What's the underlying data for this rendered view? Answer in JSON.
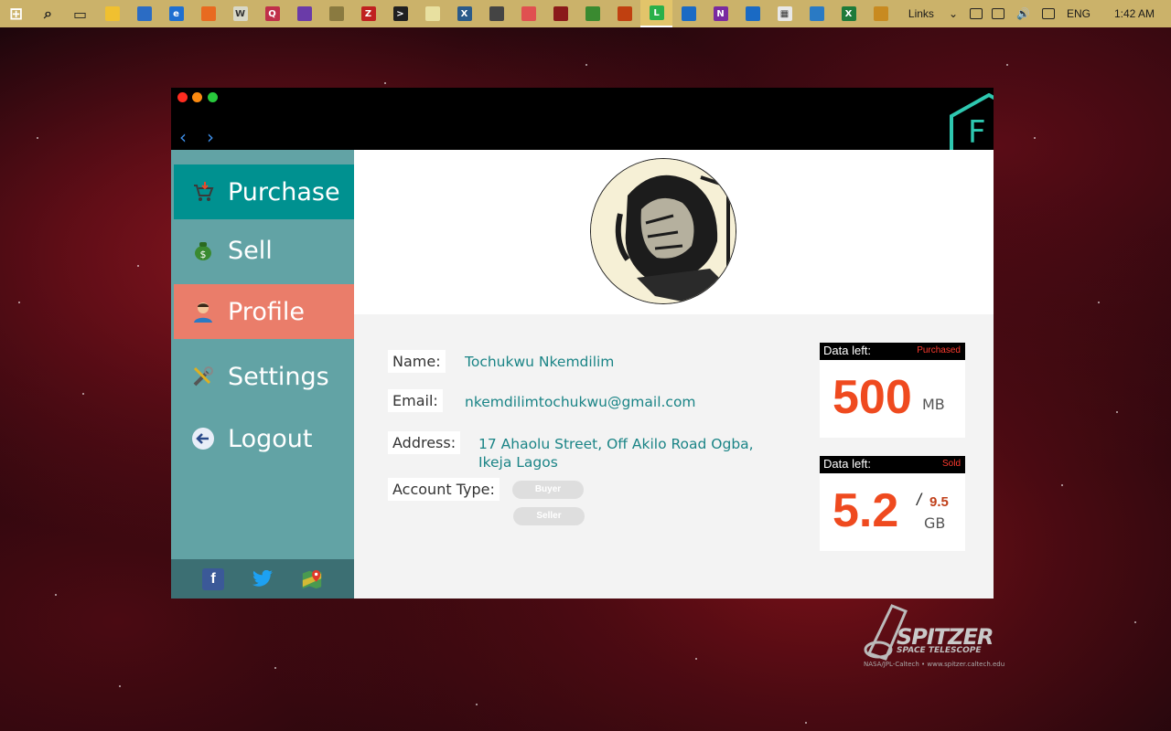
{
  "taskbar": {
    "icons": [
      {
        "name": "windows-start-icon",
        "color": "#ffffff",
        "glyph": "⊞"
      },
      {
        "name": "search-icon",
        "color": "#222222",
        "glyph": "⌕"
      },
      {
        "name": "task-view-icon",
        "color": "#222222",
        "glyph": "▭"
      },
      {
        "name": "file-explorer-icon",
        "color": "#f0c030",
        "glyph": ""
      },
      {
        "name": "store-icon",
        "color": "#2b6cc4",
        "glyph": ""
      },
      {
        "name": "edge-browser-icon",
        "color": "#1f6fd0",
        "glyph": "e"
      },
      {
        "name": "app-orange-icon",
        "color": "#e86a20",
        "glyph": ""
      },
      {
        "name": "word-doc-icon",
        "color": "#d8d8c8",
        "glyph": "W"
      },
      {
        "name": "q-app-icon",
        "color": "#c0304a",
        "glyph": "Q"
      },
      {
        "name": "visual-studio-icon",
        "color": "#6a3ba8",
        "glyph": ""
      },
      {
        "name": "tools-icon",
        "color": "#8a7a40",
        "glyph": ""
      },
      {
        "name": "filezilla-icon",
        "color": "#c02020",
        "glyph": "Z"
      },
      {
        "name": "terminal-icon",
        "color": "#202020",
        "glyph": ">"
      },
      {
        "name": "notepad-icon",
        "color": "#e8e0a0",
        "glyph": ""
      },
      {
        "name": "xbox-icon",
        "color": "#2a5a8a",
        "glyph": "X"
      },
      {
        "name": "app-dark-icon",
        "color": "#444444",
        "glyph": ""
      },
      {
        "name": "app-pink-icon",
        "color": "#e05050",
        "glyph": ""
      },
      {
        "name": "acrobat-icon",
        "color": "#8a1a1a",
        "glyph": ""
      },
      {
        "name": "app-green-icon",
        "color": "#3a8a30",
        "glyph": ""
      },
      {
        "name": "app-compass-icon",
        "color": "#c04010",
        "glyph": ""
      },
      {
        "name": "line-chat-icon",
        "color": "#2ab04a",
        "glyph": "L"
      },
      {
        "name": "contacts-icon",
        "color": "#1a6ac4",
        "glyph": ""
      },
      {
        "name": "onenote-icon",
        "color": "#7a2aa0",
        "glyph": "N"
      },
      {
        "name": "outlook-icon",
        "color": "#1a6ac4",
        "glyph": ""
      },
      {
        "name": "calculator-icon",
        "color": "#e8e8e8",
        "glyph": "▦"
      },
      {
        "name": "remote-desktop-icon",
        "color": "#2a7ac4",
        "glyph": ""
      },
      {
        "name": "excel-icon",
        "color": "#1e7a3a",
        "glyph": "X"
      },
      {
        "name": "app-grid-icon",
        "color": "#c88a20",
        "glyph": ""
      }
    ],
    "tray": {
      "links": "Links",
      "language": "ENG",
      "time": "1:42 AM"
    }
  },
  "window": {
    "brand_letter": "F"
  },
  "sidebar": {
    "items": [
      {
        "label": "Purchase"
      },
      {
        "label": "Sell"
      },
      {
        "label": "Profile"
      },
      {
        "label": "Settings"
      },
      {
        "label": "Logout"
      }
    ]
  },
  "profile": {
    "name_label": "Name:",
    "name_value": "Tochukwu Nkemdilim",
    "email_label": "Email:",
    "email_value": "nkemdilimtochukwu@gmail.com",
    "address_label": "Address:",
    "address_line1": "17 Ahaolu Street, Off Akilo Road Ogba,",
    "address_line2": "Ikeja Lagos",
    "account_type_label": "Account Type:",
    "account_options": [
      "Buyer",
      "Seller"
    ]
  },
  "cards": {
    "purchased": {
      "label": "Data left:",
      "tag": "Purchased",
      "value": "500",
      "unit": "MB"
    },
    "sold": {
      "label": "Data left:",
      "tag": "Sold",
      "value": "5.2",
      "total": "9.5",
      "separator": "/",
      "unit": "GB"
    }
  },
  "wallpaper": {
    "logo_title": "SPITZER",
    "logo_subtitle": "SPACE TELESCOPE",
    "credit": "NASA/JPL-Caltech • www.spitzer.caltech.edu"
  },
  "colors": {
    "teal_active": "#009190",
    "sidebar": "#62a3a5",
    "profile_active": "#ea7d6a",
    "value_text": "#1a8486",
    "data_number": "#ef4a1f"
  }
}
